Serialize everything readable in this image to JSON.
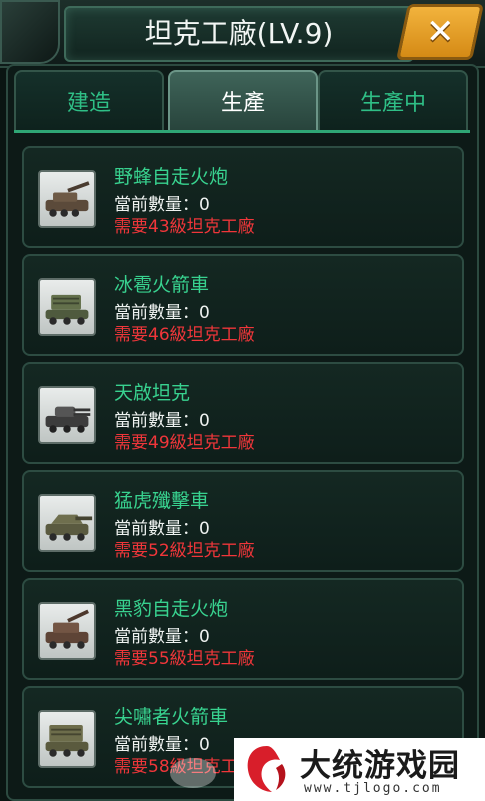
{
  "window": {
    "title": "坦克工廠(LV.9)",
    "close_icon": "close-x-icon"
  },
  "tabs": [
    {
      "label": "建造",
      "active": false
    },
    {
      "label": "生產",
      "active": true
    },
    {
      "label": "生產中",
      "active": false
    }
  ],
  "units": [
    {
      "name": "野蜂自走火炮",
      "quantity": "當前數量：0",
      "requirement": "需要43級坦克工廠",
      "icon": "self-propelled-gun-icon"
    },
    {
      "name": "冰雹火箭車",
      "quantity": "當前數量：0",
      "requirement": "需要46級坦克工廠",
      "icon": "rocket-launcher-icon"
    },
    {
      "name": "天啟坦克",
      "quantity": "當前數量：0",
      "requirement": "需要49級坦克工廠",
      "icon": "heavy-tank-icon"
    },
    {
      "name": "猛虎殲擊車",
      "quantity": "當前數量：0",
      "requirement": "需要52級坦克工廠",
      "icon": "tank-destroyer-icon"
    },
    {
      "name": "黑豹自走火炮",
      "quantity": "當前數量：0",
      "requirement": "需要55級坦克工廠",
      "icon": "self-propelled-gun-icon"
    },
    {
      "name": "尖嘯者火箭車",
      "quantity": "當前數量：0",
      "requirement": "需要58級坦克工廠",
      "icon": "rocket-launcher-icon"
    }
  ],
  "watermark": {
    "title": "大统游戏园",
    "url": "www.tjlogo.com"
  },
  "colors": {
    "unit_name": "#38d28f",
    "requirement": "#f0363a",
    "tab_text": "#2fbf86",
    "close_button": "#f2b33d"
  }
}
